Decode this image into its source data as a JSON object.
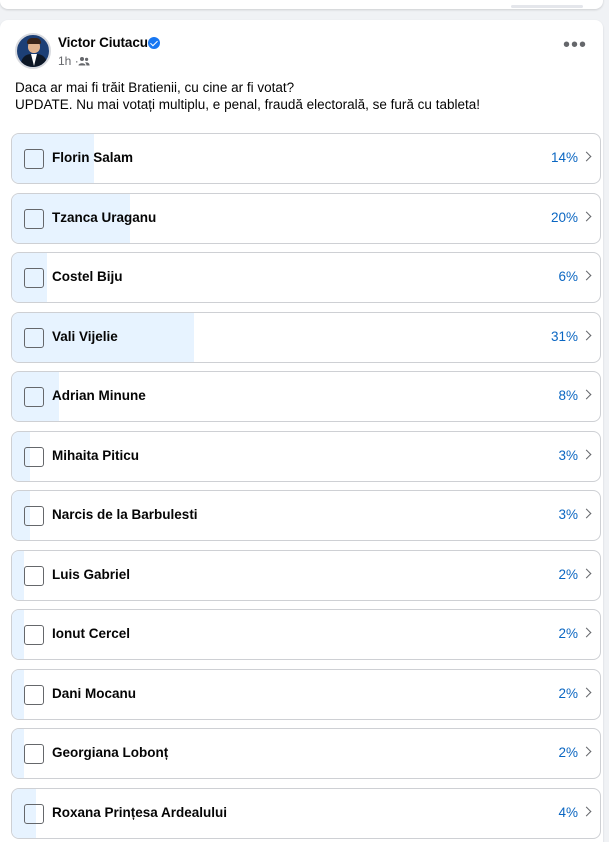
{
  "post": {
    "author": "Victor Ciutacu",
    "time": "1h",
    "audience_icon": "friends-icon",
    "more_icon": "more-horizontal-icon",
    "text_line1": "Daca ar mai fi trăit Bratienii, cu cine ar fi votat?",
    "text_line2": "UPDATE. Nu mai votați multiplu, e penal, fraudă electorală, se fură cu tableta!",
    "more_label": "•••"
  },
  "colors": {
    "accent": "#0a66c2",
    "fill": "#e7f3ff",
    "verified": "#1877f2"
  },
  "poll": {
    "options": [
      {
        "label": "Florin Salam",
        "pct": "14%",
        "value": 14
      },
      {
        "label": "Tzanca Uraganu",
        "pct": "20%",
        "value": 20
      },
      {
        "label": "Costel Biju",
        "pct": "6%",
        "value": 6
      },
      {
        "label": "Vali Vijelie",
        "pct": "31%",
        "value": 31
      },
      {
        "label": "Adrian Minune",
        "pct": "8%",
        "value": 8
      },
      {
        "label": "Mihaita Piticu",
        "pct": "3%",
        "value": 3
      },
      {
        "label": "Narcis de la Barbulesti",
        "pct": "3%",
        "value": 3
      },
      {
        "label": "Luis Gabriel",
        "pct": "2%",
        "value": 2
      },
      {
        "label": "Ionut Cercel",
        "pct": "2%",
        "value": 2
      },
      {
        "label": "Dani Mocanu",
        "pct": "2%",
        "value": 2
      },
      {
        "label": "Georgiana Lobonț",
        "pct": "2%",
        "value": 2
      },
      {
        "label": "Roxana Prințesa Ardealului",
        "pct": "4%",
        "value": 4
      }
    ]
  }
}
